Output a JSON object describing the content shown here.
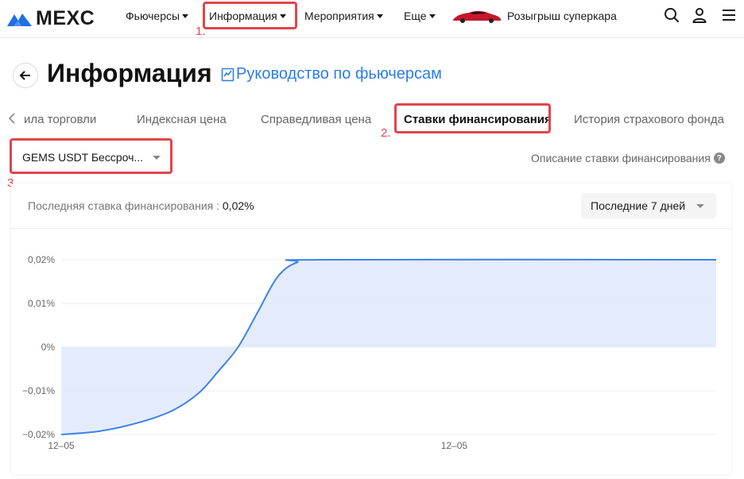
{
  "brand": {
    "name": "MEXC",
    "accent": "#2b7de9"
  },
  "nav": {
    "items": [
      {
        "label": "Фьючерсы"
      },
      {
        "label": "Информация"
      },
      {
        "label": "Мероприятия"
      },
      {
        "label": "Еще"
      }
    ],
    "promo_label": "Розыгрыш суперкара",
    "icons": [
      "search-icon",
      "user-icon",
      "menu-icon"
    ]
  },
  "annotations": {
    "one": "1.",
    "two": "2.",
    "three": "3.",
    "color": "#e0454c"
  },
  "header": {
    "title": "Информация",
    "guide_link": "Руководство по фьючерсам"
  },
  "tabs": [
    {
      "label": "ила торговли"
    },
    {
      "label": "Индексная цена"
    },
    {
      "label": "Справедливая цена"
    },
    {
      "label": "Ставки финансирования",
      "active": true
    },
    {
      "label": "История страхового фонда"
    }
  ],
  "selector": {
    "symbol": "GEMS USDT Бессроч...",
    "description_link": "Описание ставки финансирования"
  },
  "card": {
    "last_rate_label": "Последняя ставка финансирования :",
    "last_rate_value": "0,02%",
    "period": "Последние 7 дней"
  },
  "chart_data": {
    "type": "area",
    "y_ticks": [
      "0,02%",
      "0,01%",
      "0%",
      "−0,01%",
      "−0,02%"
    ],
    "x_ticks": [
      "12–05",
      "12–05"
    ],
    "ylim": [
      -0.02,
      0.02
    ],
    "series": [
      {
        "x": [
          0,
          0.06,
          0.12,
          0.17,
          0.21,
          0.24,
          0.27,
          0.3,
          0.33,
          0.36,
          0.4,
          1.0
        ],
        "values": [
          -0.02,
          -0.0192,
          -0.0172,
          -0.0145,
          -0.0105,
          -0.0055,
          0.0,
          0.008,
          0.016,
          0.0194,
          0.02,
          0.02
        ]
      }
    ],
    "line_color": "#3b82e8",
    "fill_color": "#dfe9fb"
  }
}
